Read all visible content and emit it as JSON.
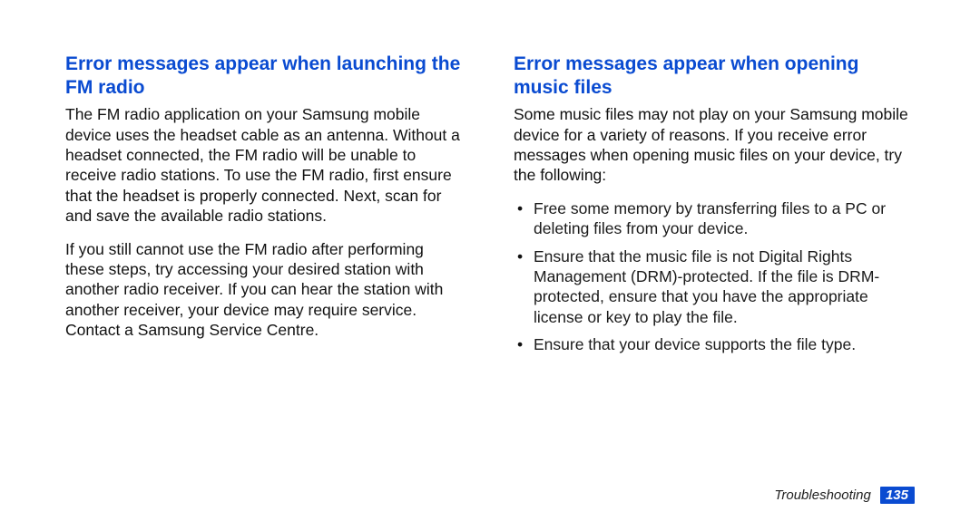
{
  "columns": {
    "left": {
      "heading": "Error messages appear when launching the FM radio",
      "p1": "The FM radio application on your Samsung mobile device uses the headset cable as an antenna. Without a headset connected, the FM radio will be unable to receive radio stations. To use the FM radio, first ensure that the headset is properly connected. Next, scan for and save the available radio stations.",
      "p2": "If you still cannot use the FM radio after performing these steps, try accessing your desired station with another radio receiver. If you can hear the station with another receiver, your device may require service. Contact a Samsung Service Centre."
    },
    "right": {
      "heading": "Error messages appear when opening music files",
      "p1": "Some music files may not play on your Samsung mobile device for a variety of reasons. If you receive error messages when opening music files on your device, try the following:",
      "bullets": [
        "Free some memory by transferring files to a PC or deleting files from your device.",
        "Ensure that the music file is not Digital Rights Management (DRM)-protected. If the file is DRM-protected, ensure that you have the appropriate license or key to play the file.",
        "Ensure that your device supports the file type."
      ]
    }
  },
  "footer": {
    "section": "Troubleshooting",
    "page": "135"
  }
}
